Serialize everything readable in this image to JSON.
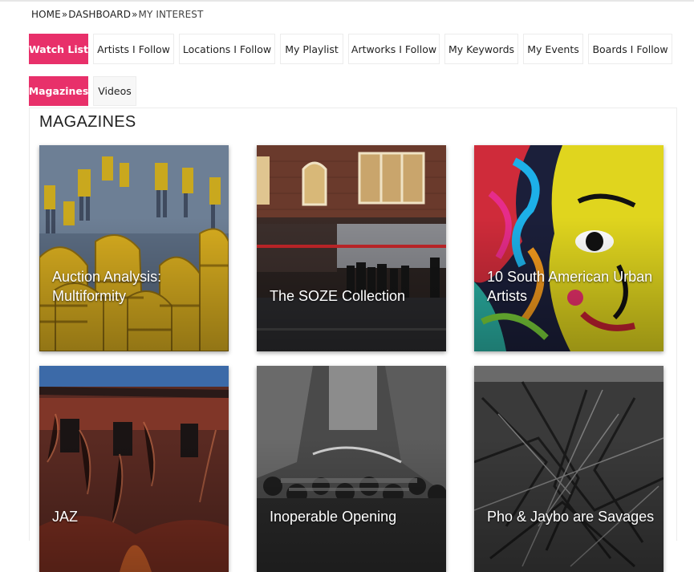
{
  "breadcrumb": {
    "home": "HOME",
    "dashboard": "DASHBOARD",
    "separator": "»",
    "current": "MY INTEREST"
  },
  "tabs": [
    {
      "label": "Watch List",
      "active": true
    },
    {
      "label": "Artists I Follow",
      "active": false
    },
    {
      "label": "Locations I Follow",
      "active": false
    },
    {
      "label": "My Playlist",
      "active": false
    },
    {
      "label": "Artworks I Follow",
      "active": false
    },
    {
      "label": "My Keywords",
      "active": false
    },
    {
      "label": "My Events",
      "active": false
    },
    {
      "label": "Boards I Follow",
      "active": false
    }
  ],
  "subtabs": [
    {
      "label": "Magazines",
      "active": true
    },
    {
      "label": "Videos",
      "active": false
    }
  ],
  "section": {
    "title": "MAGAZINES"
  },
  "cards": [
    {
      "title_line1": "Auction Analysis:",
      "title_line2": "Multiformity"
    },
    {
      "title_line1": "",
      "title_line2": "The SOZE Collection"
    },
    {
      "title_line1": "10 South American Urban",
      "title_line2": "Artists"
    },
    {
      "title_line1": "JAZ",
      "title_line2": ""
    },
    {
      "title_line1": "Inoperable Opening",
      "title_line2": ""
    },
    {
      "title_line1": "Pho & Jaybo are Savages",
      "title_line2": ""
    }
  ],
  "colors": {
    "accent": "#e8306a"
  }
}
